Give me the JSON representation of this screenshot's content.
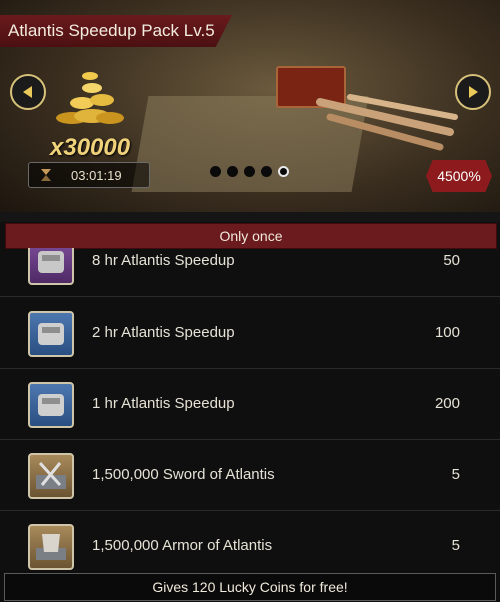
{
  "banner": {
    "title": "Atlantis Speedup Pack Lv.5",
    "quantity": "x30000",
    "timer": "03:01:19",
    "percent_badge": "4500%",
    "carousel_pages": 5,
    "carousel_active": 5,
    "icons": {
      "prev": "arrow-left-icon",
      "next": "arrow-right-icon",
      "timer": "hourglass-icon",
      "reward": "gold-coins-icon"
    }
  },
  "section_label": "Only once",
  "items": [
    {
      "name": "8 hr Atlantis Speedup",
      "qty": "50",
      "icon": "speedup-gauntlet-icon",
      "frame": "purple"
    },
    {
      "name": "2 hr Atlantis Speedup",
      "qty": "100",
      "icon": "speedup-gauntlet-icon",
      "frame": "blue"
    },
    {
      "name": "1 hr Atlantis Speedup",
      "qty": "200",
      "icon": "speedup-gauntlet-icon",
      "frame": "blue"
    },
    {
      "name": "1,500,000 Sword of Atlantis",
      "qty": "5",
      "icon": "sword-crate-icon",
      "frame": "tan"
    },
    {
      "name": "1,500,000 Armor of Atlantis",
      "qty": "5",
      "icon": "armor-crate-icon",
      "frame": "tan"
    }
  ],
  "footer": "Gives 120 Lucky Coins for free!",
  "colors": {
    "accent_red": "#6b1a1d",
    "gold": "#f0d27a",
    "badge_red": "#8d1b1e"
  }
}
